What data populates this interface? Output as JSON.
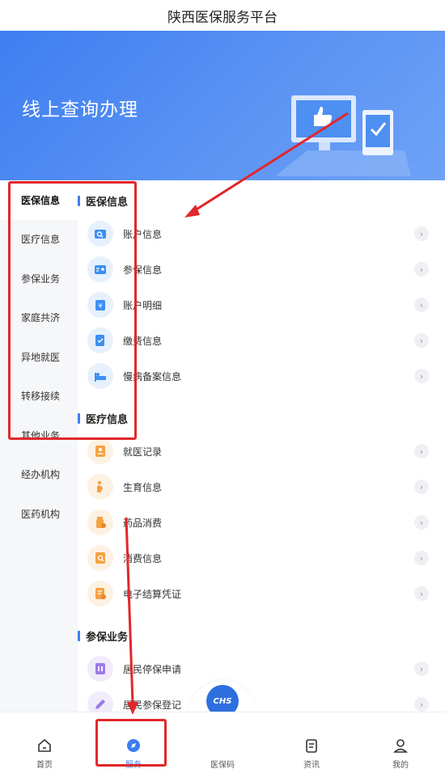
{
  "title": "陕西医保服务平台",
  "banner": {
    "title": "线上查询办理"
  },
  "sidebar": {
    "items": [
      {
        "label": "医保信息",
        "active": true
      },
      {
        "label": "医疗信息"
      },
      {
        "label": "参保业务"
      },
      {
        "label": "家庭共济"
      },
      {
        "label": "异地就医"
      },
      {
        "label": "转移接续"
      },
      {
        "label": "其他业务"
      },
      {
        "label": "经办机构"
      },
      {
        "label": "医药机构"
      }
    ]
  },
  "sections": [
    {
      "title": "医保信息",
      "items": [
        {
          "label": "账户信息",
          "icon": "account-info-icon"
        },
        {
          "label": "参保信息",
          "icon": "insured-card-icon"
        },
        {
          "label": "账户明细",
          "icon": "account-detail-icon"
        },
        {
          "label": "缴费信息",
          "icon": "payment-icon"
        },
        {
          "label": "慢病备案信息",
          "icon": "bed-icon"
        }
      ]
    },
    {
      "title": "医疗信息",
      "items": [
        {
          "label": "就医记录",
          "icon": "medical-record-icon"
        },
        {
          "label": "生育信息",
          "icon": "maternity-icon"
        },
        {
          "label": "药品消费",
          "icon": "medicine-icon"
        },
        {
          "label": "消费信息",
          "icon": "consumption-icon"
        },
        {
          "label": "电子结算凭证",
          "icon": "receipt-icon"
        }
      ]
    },
    {
      "title": "参保业务",
      "items": [
        {
          "label": "居民停保申请",
          "icon": "stop-insurance-icon"
        },
        {
          "label": "居民参保登记",
          "icon": "register-icon"
        }
      ]
    }
  ],
  "tabbar": {
    "home": "首页",
    "service": "服务",
    "code": "医保码",
    "news": "资讯",
    "mine": "我的",
    "center_badge": "CHS"
  },
  "colors": {
    "accent": "#3d7ef0",
    "annotation": "#e1272b"
  }
}
